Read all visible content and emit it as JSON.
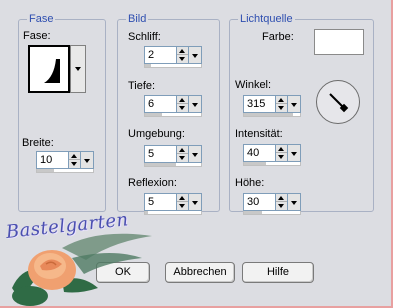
{
  "groups": {
    "fase": {
      "title": "Fase",
      "fase_label": "Fase:",
      "breite_label": "Breite:",
      "breite_value": "10",
      "breite_level": 0.3
    },
    "bild": {
      "title": "Bild",
      "schliff_label": "Schliff:",
      "schliff_value": "2",
      "schliff_level": 0.1,
      "tiefe_label": "Tiefe:",
      "tiefe_value": "6",
      "tiefe_level": 0.3,
      "umgebung_label": "Umgebung:",
      "umgebung_value": "5",
      "umgebung_level": 0.55,
      "reflexion_label": "Reflexion:",
      "reflexion_value": "5",
      "reflexion_level": 0.05
    },
    "lichtquelle": {
      "title": "Lichtquelle",
      "farbe_label": "Farbe:",
      "farbe_color": "#ffffff",
      "winkel_label": "Winkel:",
      "winkel_value": "315",
      "winkel_level": 0.87,
      "intensitaet_label": "Intensität:",
      "intensitaet_value": "40",
      "intensitaet_level": 0.4,
      "hoehe_label": "Höhe:",
      "hoehe_value": "30",
      "hoehe_level": 0.33
    }
  },
  "buttons": {
    "ok": "OK",
    "abbrechen": "Abbrechen",
    "hilfe": "Hilfe"
  },
  "watermark": {
    "text": "Bastelgarten"
  },
  "colors": {
    "group_title": "#2f4fb0",
    "background": "#dcdde2",
    "border_accent": "#e8a0a0"
  },
  "icons": [
    "spinner-up-icon",
    "spinner-down-icon",
    "dropdown-icon",
    "bevel-shape-icon",
    "angle-dial-icon",
    "rose-icon"
  ]
}
